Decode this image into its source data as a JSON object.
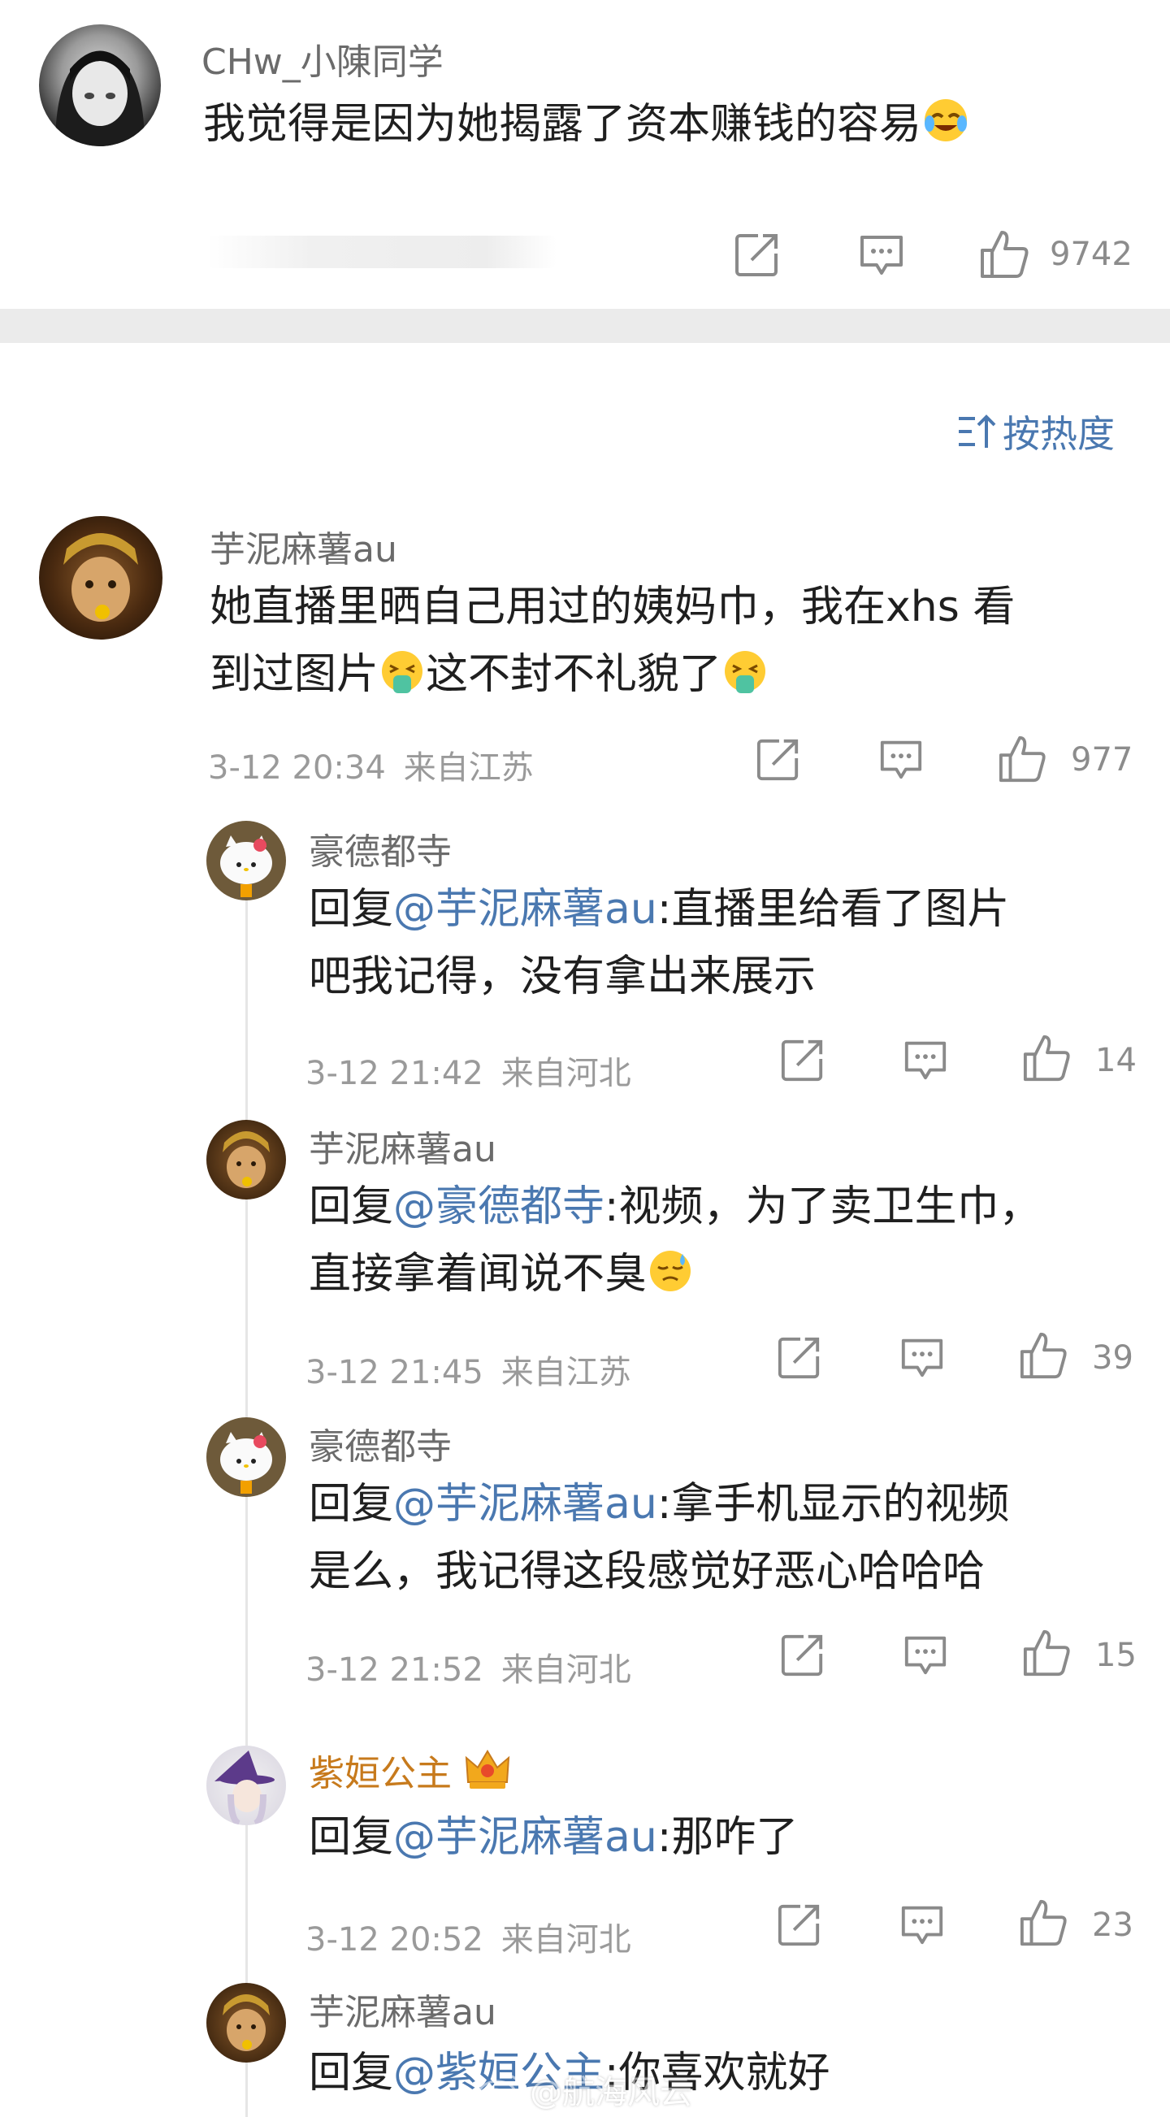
{
  "top_comment": {
    "username": "CHw_小陳同学",
    "text": "我觉得是因为她揭露了资本赚钱的容易",
    "likes": "9742"
  },
  "sort": {
    "label": "按热度",
    "icon": "sort-icon"
  },
  "main_comment": {
    "username": "芋泥麻薯au",
    "text_line1": "她直播里晒自己用过的姨妈巾，我在xhs 看",
    "text_line2_a": "到过图片",
    "text_line2_b": "这不封不礼貌了",
    "time": "3-12 20:34",
    "location": "来自江苏",
    "likes": "977"
  },
  "replies": [
    {
      "username": "豪德都寺",
      "reply_prefix": "回复",
      "mention": "@芋泥麻薯au",
      "line1_rest": ":直播里给看了图片",
      "line2": "吧我记得，没有拿出来展示",
      "time": "3-12 21:42",
      "location": "来自河北",
      "likes": "14"
    },
    {
      "username": "芋泥麻薯au",
      "reply_prefix": "回复",
      "mention": "@豪德都寺",
      "line1_rest": ":视频，为了卖卫生巾，",
      "line2": "直接拿着闻说不臭",
      "time": "3-12 21:45",
      "location": "来自江苏",
      "likes": "39"
    },
    {
      "username": "豪德都寺",
      "reply_prefix": "回复",
      "mention": "@芋泥麻薯au",
      "line1_rest": ":拿手机显示的视频",
      "line2": "是么，我记得这段感觉好恶心哈哈哈",
      "time": "3-12 21:52",
      "location": "来自河北",
      "likes": "15"
    },
    {
      "username": "紫姮公主",
      "reply_prefix": "回复",
      "mention": "@芋泥麻薯au",
      "line1_rest": ":那咋了",
      "time": "3-12 20:52",
      "location": "来自河北",
      "likes": "23"
    },
    {
      "username": "芋泥麻薯au",
      "reply_prefix": "回复",
      "mention": "@紫姮公主",
      "line1_rest": ":你喜欢就好"
    }
  ],
  "watermark": "@航海风云",
  "colors": {
    "mention": "#4a78b0",
    "vip_name": "#c77a1c",
    "divider": "#ebebeb",
    "icon": "#8a8a8a"
  }
}
